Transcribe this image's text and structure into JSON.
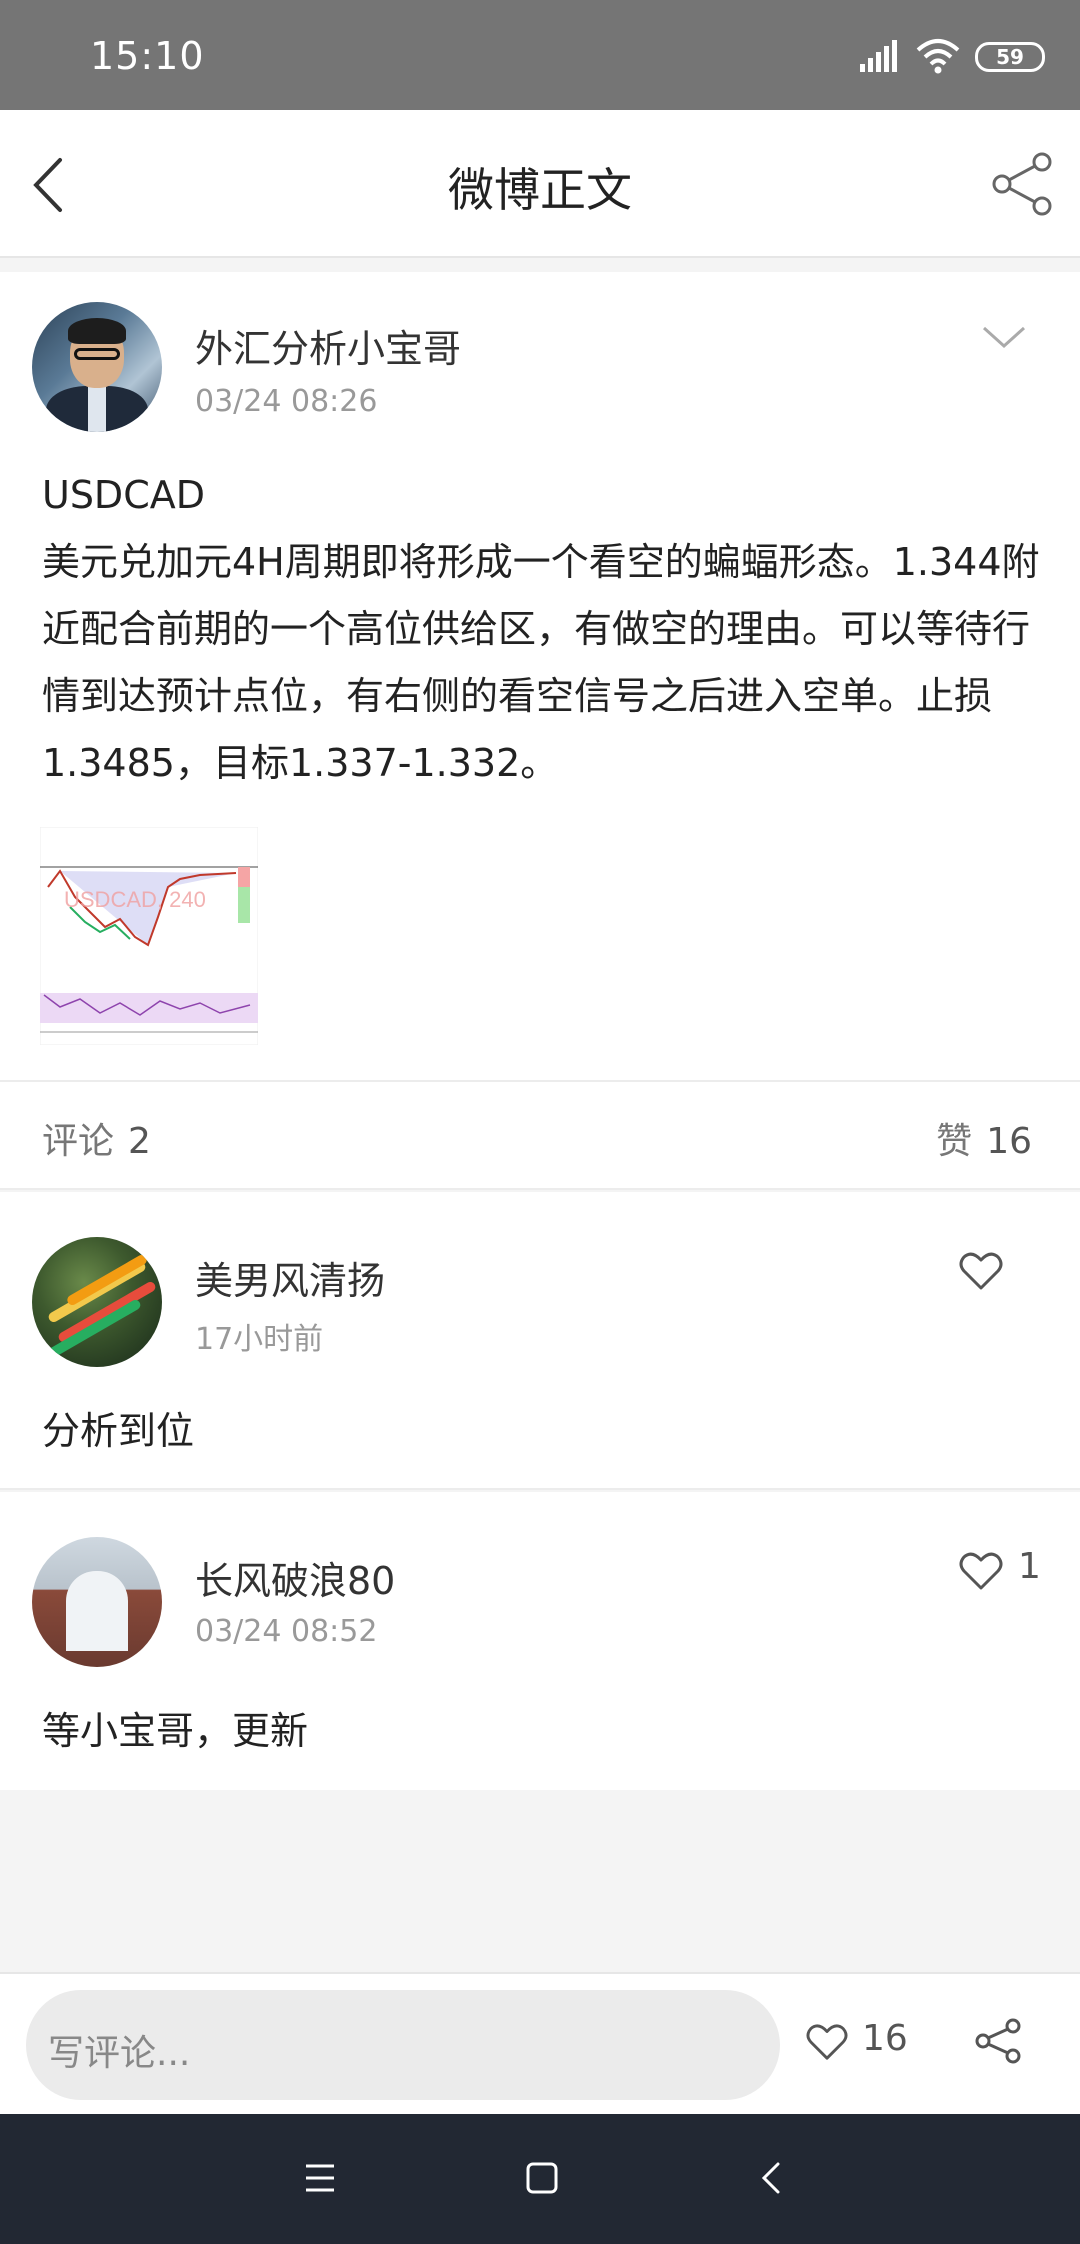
{
  "status_bar": {
    "time": "15:10",
    "battery": "59"
  },
  "header": {
    "title": "微博正文",
    "back_icon": "back-arrow-icon",
    "share_icon": "share-icon"
  },
  "post": {
    "author": "外汇分析小宝哥",
    "time": "03/24 08:26",
    "symbol": "USDCAD",
    "text": "美元兑加元4H周期即将形成一个看空的蝙蝠形态。1.344附近配合前期的一个高位供给区，有做空的理由。可以等待行情到达预计点位，有右侧的看空信号之后进入空单。止损1.3485，目标1.337-1.332。",
    "image_watermark": "USDCAD, 240"
  },
  "stats": {
    "comments_label": "评论",
    "comments_count": "2",
    "likes_label": "赞",
    "likes_count": "16"
  },
  "comments": [
    {
      "author": "美男风清扬",
      "time": "17小时前",
      "text": "分析到位",
      "likes": ""
    },
    {
      "author": "长风破浪80",
      "time": "03/24 08:52",
      "text": "等小宝哥，更新",
      "likes": "1"
    }
  ],
  "bottom_bar": {
    "placeholder": "写评论...",
    "like_count": "16"
  },
  "colors": {
    "status_bar": "#757575",
    "nav_bar": "#222833",
    "text_gray": "#999999"
  }
}
